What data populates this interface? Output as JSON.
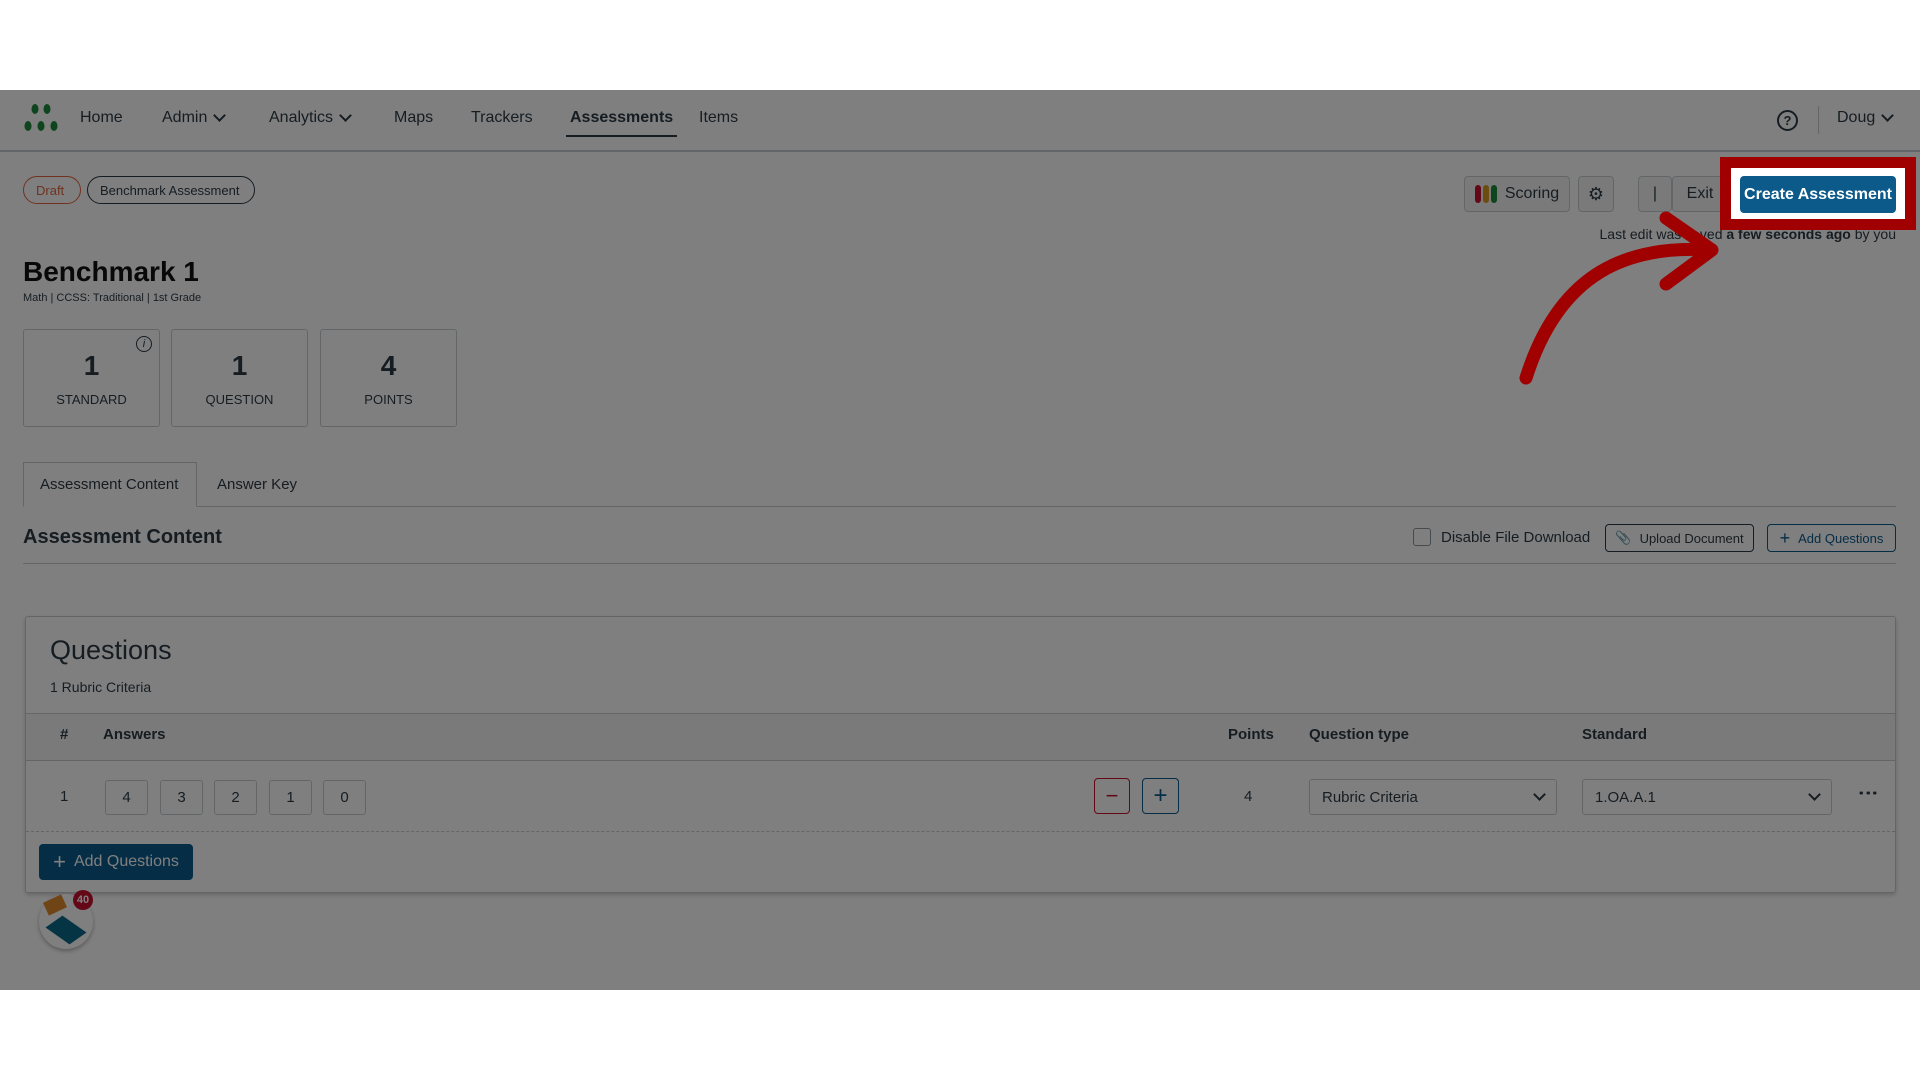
{
  "nav": {
    "items": [
      {
        "label": "Home"
      },
      {
        "label": "Admin",
        "dropdown": true
      },
      {
        "label": "Analytics",
        "dropdown": true
      },
      {
        "label": "Maps"
      },
      {
        "label": "Trackers"
      },
      {
        "label": "Assessments",
        "active": true
      },
      {
        "label": "Items"
      }
    ],
    "user": "Doug"
  },
  "badges": {
    "status": "Draft",
    "type": "Benchmark Assessment"
  },
  "toolbar": {
    "scoring": "Scoring",
    "exit": "Exit",
    "create": "Create Assessment",
    "save_prefix": "Last edit was saved ",
    "save_time": "a few seconds ago",
    "save_suffix": " by you"
  },
  "assessment": {
    "title": "Benchmark 1",
    "meta": "Math | CCSS: Traditional | 1st Grade"
  },
  "stats": [
    {
      "value": "1",
      "label": "STANDARD"
    },
    {
      "value": "1",
      "label": "QUESTION"
    },
    {
      "value": "4",
      "label": "POINTS"
    }
  ],
  "tabs": [
    {
      "label": "Assessment Content",
      "active": true
    },
    {
      "label": "Answer Key"
    }
  ],
  "section": {
    "title": "Assessment Content",
    "disable_download": "Disable File Download",
    "upload": "Upload Document",
    "add": "Add Questions"
  },
  "questions": {
    "title": "Questions",
    "subtitle": "1 Rubric Criteria",
    "headers": {
      "num": "#",
      "answers": "Answers",
      "points": "Points",
      "type": "Question type",
      "standard": "Standard"
    },
    "rows": [
      {
        "num": "1",
        "answers": [
          "4",
          "3",
          "2",
          "1",
          "0"
        ],
        "points": "4",
        "type": "Rubric Criteria",
        "standard": "1.OA.A.1"
      }
    ],
    "add": "Add Questions"
  },
  "widget": {
    "count": "40"
  },
  "colors": {
    "primary": "#0b5a8a",
    "danger": "#c8102e",
    "draft": "#e0653c",
    "highlight": "#a00000"
  }
}
